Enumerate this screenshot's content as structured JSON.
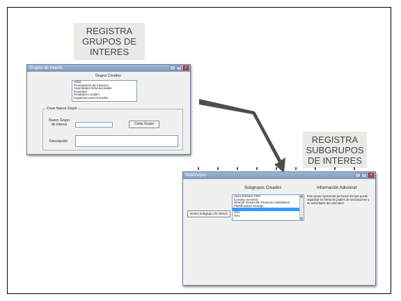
{
  "captions": {
    "grupos": [
      "REGISTRA",
      "GRUPOS DE",
      "INTERES"
    ],
    "subgrupos": [
      "REGISTRA",
      "SUBGRUPOS",
      "DE INTERES"
    ]
  },
  "colors": {
    "arrow": "#4d4d4d",
    "caption_bg": "#e9e9e6",
    "selection": "#3399ff",
    "titlebar": "#8aa4c7"
  },
  "window1": {
    "title": "Grupos de Interés",
    "heading": "Grupos Creados",
    "list_items": [
      "USM",
      "Proveedores de Insumos",
      "Autoridades Educacionales",
      "Docentes",
      "Entidades Locales",
      "Organizaciones Sociales"
    ],
    "group_label": "Crear Nuevo Grupo",
    "name_label": "Nuevo Grupo de Interes",
    "name_value": "",
    "add_button": "Crear Grupo",
    "desc_label": "Descripción",
    "desc_value": ""
  },
  "window2": {
    "title": "SubGrupos",
    "heading": "Subgrupos Creados",
    "info_heading": "Información Adicional",
    "list_items": [
      "Aseo Director CFN",
      "Consejo General",
      "Director Desarrollo Proyecto Voluntarios",
      "Planificadora Sesego",
      "",
      "Otro",
      "Otro"
    ],
    "selected_index": 4,
    "new_button": "Nuevo subgrupo de Interes",
    "info_text": "Este grupo representa personas del que puede organizar en forma de padres de asociaciones y de actividades del voluntario"
  },
  "icons": [
    "minimize-icon",
    "maximize-icon",
    "close-icon",
    "arrow-icon"
  ]
}
